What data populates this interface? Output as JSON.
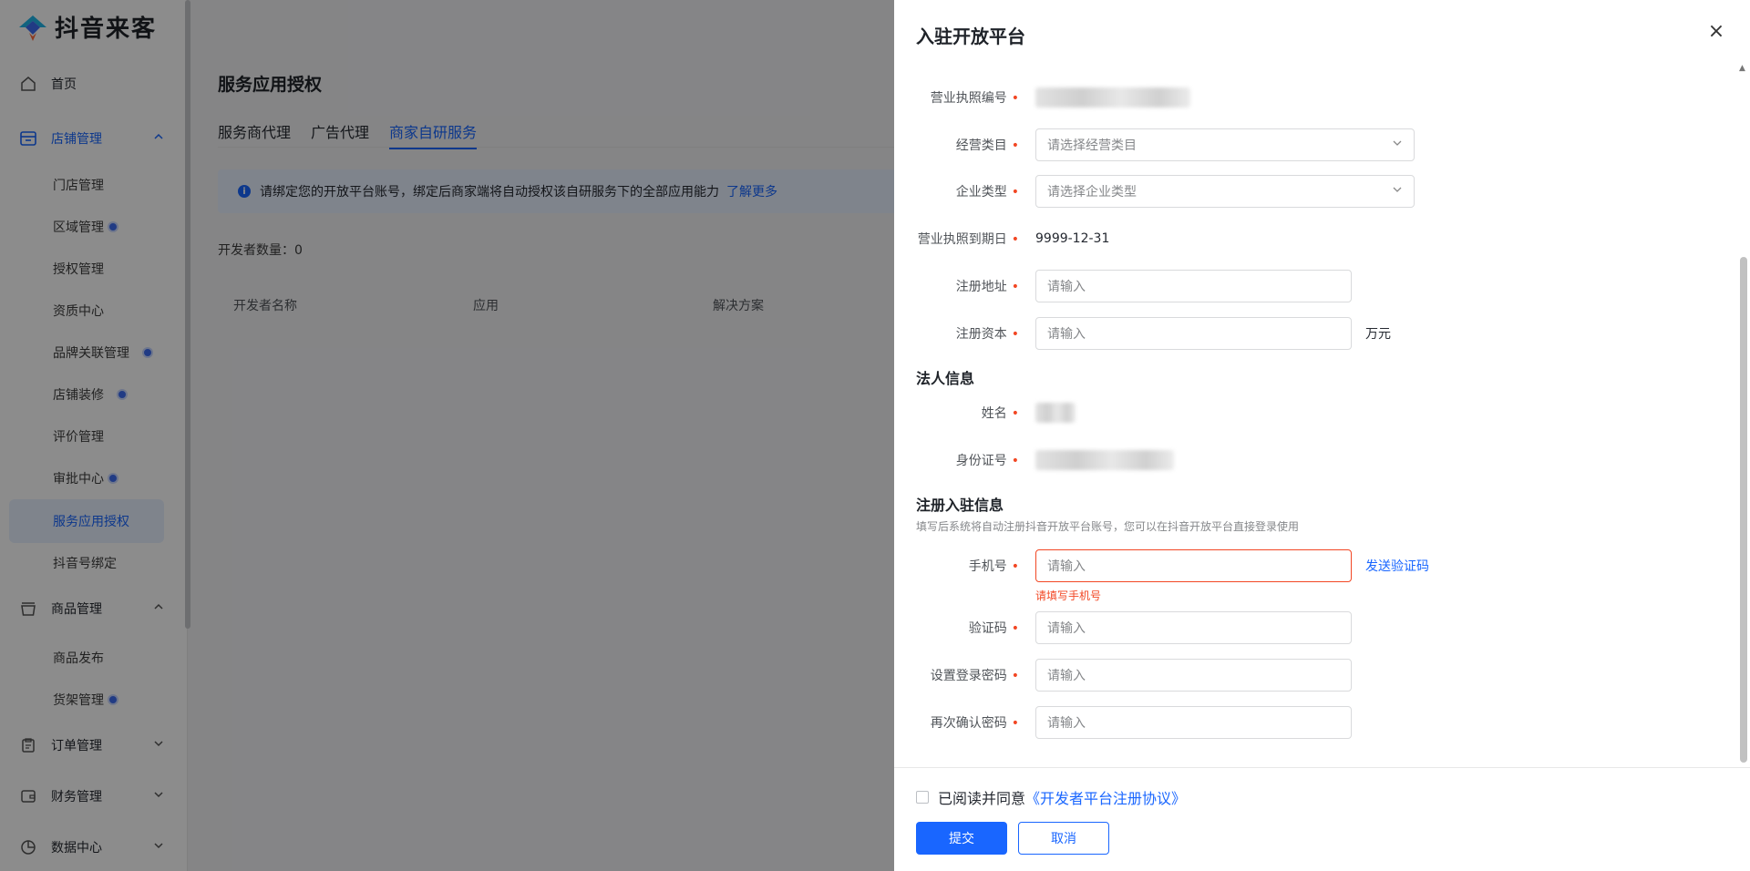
{
  "app": {
    "logo_text": "抖音来客"
  },
  "sidebar": {
    "home": "首页",
    "store_mgmt": "店铺管理",
    "store_items": [
      "门店管理",
      "区域管理",
      "授权管理",
      "资质中心",
      "品牌关联管理",
      "店铺装修",
      "评价管理",
      "审批中心",
      "服务应用授权",
      "抖音号绑定"
    ],
    "goods_mgmt": "商品管理",
    "goods_items": [
      "商品发布",
      "货架管理"
    ],
    "order_mgmt": "订单管理",
    "finance_mgmt": "财务管理",
    "data_center": "数据中心"
  },
  "main": {
    "title": "服务应用授权",
    "tabs": [
      "服务商代理",
      "广告代理",
      "商家自研服务"
    ],
    "notice": "请绑定您的开放平台账号，绑定后商家端将自动授权该自研服务下的全部应用能力",
    "notice_link": "了解更多",
    "dev_count": "开发者数量：0",
    "table_headers": [
      "开发者名称",
      "应用",
      "解决方案"
    ]
  },
  "drawer": {
    "title": "入驻开放平台",
    "license_no_label": "营业执照编号",
    "biz_category_label": "经营类目",
    "biz_category_placeholder": "请选择经营类目",
    "company_type_label": "企业类型",
    "company_type_placeholder": "请选择企业类型",
    "license_expiry_label": "营业执照到期日",
    "license_expiry_value": "9999-12-31",
    "reg_address_label": "注册地址",
    "reg_capital_label": "注册资本",
    "input_placeholder": "请输入",
    "capital_unit": "万元",
    "legal_section": "法人信息",
    "name_label": "姓名",
    "id_label": "身份证号",
    "register_section": "注册入驻信息",
    "register_desc": "填写后系统将自动注册抖音开放平台账号，您可以在抖音开放平台直接登录使用",
    "phone_label": "手机号",
    "send_code": "发送验证码",
    "phone_error": "请填写手机号",
    "code_label": "验证码",
    "password_label": "设置登录密码",
    "confirm_password_label": "再次确认密码",
    "agree_text": "已阅读并同意",
    "agree_link": "《开发者平台注册协议》",
    "submit": "提交",
    "cancel": "取消"
  },
  "colors": {
    "primary": "#1966ff",
    "error": "#f24724"
  }
}
